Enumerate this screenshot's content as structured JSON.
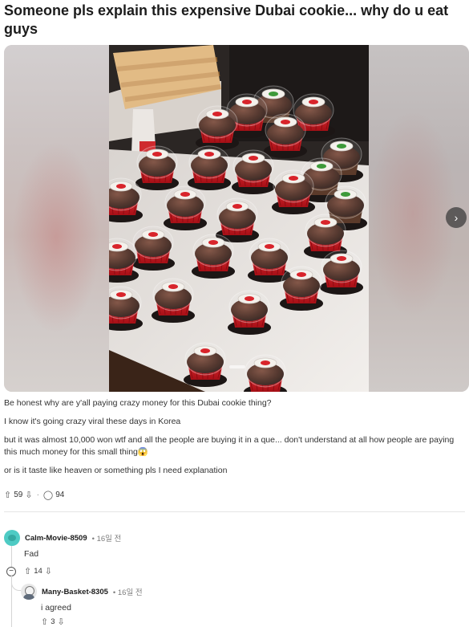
{
  "post": {
    "title": "Someone pls explain this expensive Dubai cookie... why do u eat guys",
    "paragraphs": [
      "Be honest why are y'all paying crazy money for this Dubai cookie thing?",
      "I know it's going crazy viral these days in Korea",
      "but it was almost 10,000 won wtf and all the people are buying it in a que... don't understand at all how people are paying this much money for this small thing😱",
      "or is it taste like heaven or something pls I need explanation"
    ],
    "upvotes": "59",
    "comments": "94"
  },
  "gallery": {
    "next_icon": "chevron-right-icon"
  },
  "comments": [
    {
      "author": "Calm-Movie-8509",
      "time": "16일 전",
      "text": "Fad",
      "votes": "14",
      "replies": [
        {
          "author": "Many-Basket-8305",
          "time": "16일 전",
          "text": "i agreed",
          "votes": "3"
        }
      ]
    }
  ],
  "colors": {
    "cupcake_red": "#c8161d",
    "chocolate": "#4a2a20",
    "avatar_teal": "#4ecbc4"
  }
}
